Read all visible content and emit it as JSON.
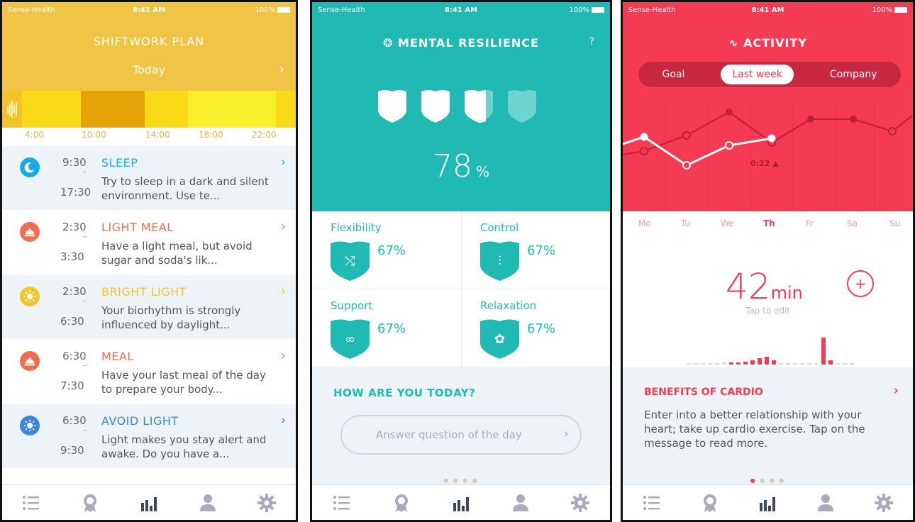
{
  "status": {
    "carrier": "Sense-Health",
    "time": "8:41 AM",
    "battery": "100%"
  },
  "p1": {
    "title": "SHIFTWORK PLAN",
    "date": "Today",
    "times": [
      "4:00",
      "10:00",
      "14:00",
      "18:00",
      "22:00"
    ],
    "items": [
      {
        "start": "9:30",
        "end": "17:30",
        "label": "SLEEP",
        "color": "#1aa9e8",
        "desc": "Try to sleep in a dark and silent environment. Use te...",
        "icon": "moon-icon"
      },
      {
        "start": "2:30",
        "end": "3:30",
        "label": "LIGHT MEAL",
        "color": "#f26d4f",
        "desc": "Have a light meal, but avoid sugar and soda's lik...",
        "icon": "cloche-icon"
      },
      {
        "start": "2:30",
        "end": "6:30",
        "label": "BRIGHT LIGHT",
        "color": "#f2c531",
        "desc": "Your biorhythm is strongly influenced by daylight...",
        "icon": "sun-icon"
      },
      {
        "start": "6:30",
        "end": "7:30",
        "label": "MEAL",
        "color": "#f26d4f",
        "desc": "Have your last meal of the day to prepare your body...",
        "icon": "cloche-icon"
      },
      {
        "start": "6:30",
        "end": "9:30",
        "label": "AVOID LIGHT",
        "color": "#3a86d9",
        "desc": "Light makes you stay alert and awake. Do you have a...",
        "icon": "sun-icon"
      }
    ]
  },
  "p2": {
    "title": "MENTAL RESILIENCE",
    "help": "?",
    "percent": "78",
    "unit": "%",
    "metrics": [
      {
        "name": "Flexibility",
        "value": "67%",
        "icon": "shuffle-icon"
      },
      {
        "name": "Control",
        "value": "67%",
        "icon": "sliders-icon"
      },
      {
        "name": "Support",
        "value": "67%",
        "icon": "link-icon"
      },
      {
        "name": "Relaxation",
        "value": "67%",
        "icon": "flower-icon"
      }
    ],
    "question_title": "HOW ARE YOU TODAY?",
    "question_button": "Answer question of the day"
  },
  "p3": {
    "title": "ACTIVITY",
    "tabs": [
      "Goal",
      "Last week",
      "Company"
    ],
    "active_tab": "Last week",
    "marker": "0:22 ▲",
    "days": [
      "Mo",
      "Tu",
      "We",
      "Th",
      "Fr",
      "Sa",
      "Su"
    ],
    "current_day": "Th",
    "minutes": "42",
    "unit": "min",
    "tap": "Tap to edit",
    "benefit_title": "BENEFITS OF CARDIO",
    "benefit_text": "Enter into a better relationship with your heart; take up cardio exercise. Tap on the message to read more."
  },
  "tabs": [
    "list-icon",
    "award-icon",
    "stats-icon",
    "profile-icon",
    "settings-icon"
  ]
}
